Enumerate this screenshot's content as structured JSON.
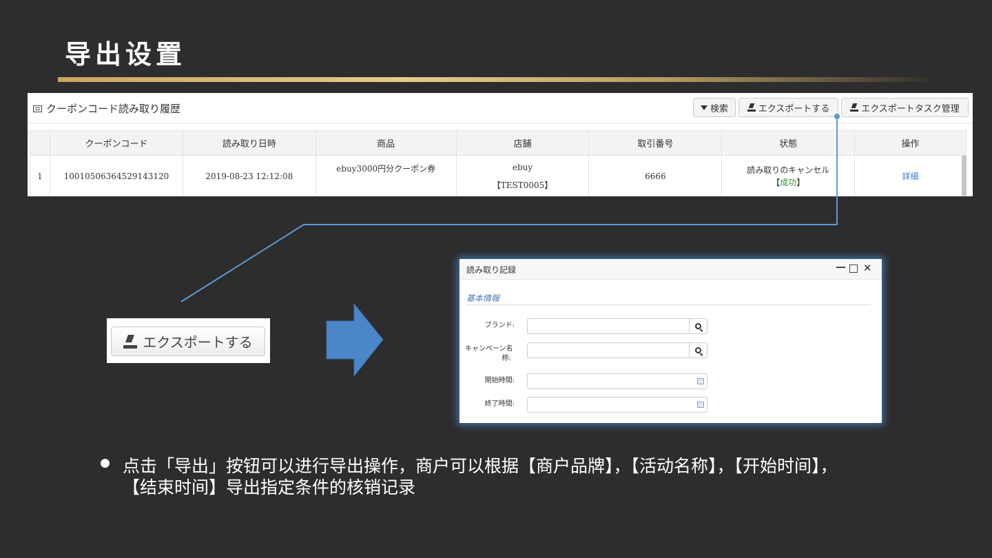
{
  "slide": {
    "title": "导出设置",
    "description": "点击「导出」按钮可以进行导出操作，商户可以根据【商户品牌】，【活动名称】，【开始时间】，【结束时间】导出指定条件的核销记录"
  },
  "panel": {
    "title": "クーポンコード読み取り履歴",
    "icon": "list-icon",
    "buttons": {
      "search": "検索",
      "export": "エクスポートする",
      "task": "エクスポートタスク管理"
    },
    "table": {
      "headers": [
        "",
        "クーポンコード",
        "読み取り日時",
        "商品",
        "店舗",
        "取引番号",
        "状態",
        "操作"
      ],
      "rows": [
        {
          "index": "1",
          "code": "10010506364529143120",
          "datetime": "2019-08-23 12:12:08",
          "product": "ebuy3000円分クーポン券",
          "store_name": "ebuy",
          "store_code": "【TEST0005】",
          "trade_no": "6666",
          "status": "読み取りのキャンセル",
          "status_result_open": "【",
          "status_result": "成功",
          "status_result_close": "】",
          "action": "詳細"
        }
      ]
    }
  },
  "zoom": {
    "export_label": "エクスポートする"
  },
  "dialog": {
    "title": "読み取り記録",
    "controls": {
      "minimize": "—",
      "close": "✕"
    },
    "section": "基本情報",
    "fields": {
      "brand": "ブランド:",
      "campaign_line1": "キャンペーン名",
      "campaign_line2": "称:",
      "start": "開始時間:",
      "end": "終了時間:"
    }
  },
  "colors": {
    "background": "#2d2d2d",
    "gold": "#c9a561",
    "connector": "#5b9bd5",
    "arrow": "#4a86c8",
    "success": "#2b9a2b",
    "link": "#3b7dc4"
  }
}
